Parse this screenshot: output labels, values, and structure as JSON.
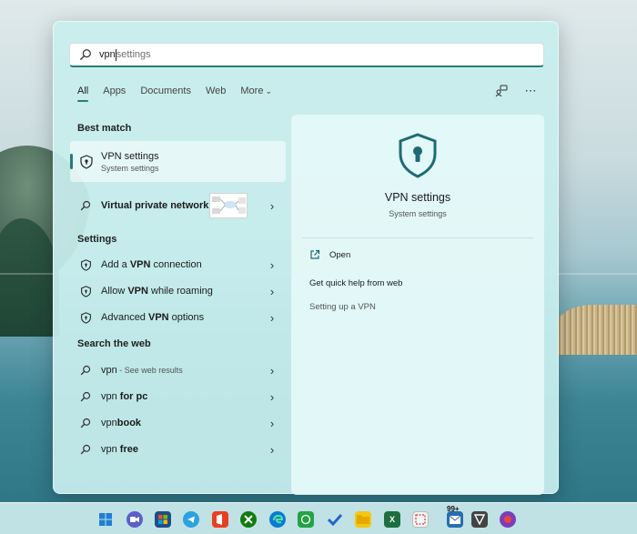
{
  "search": {
    "typed": "vpn",
    "ghost": "settings"
  },
  "tabs": [
    {
      "label": "All"
    },
    {
      "label": "Apps"
    },
    {
      "label": "Documents"
    },
    {
      "label": "Web"
    },
    {
      "label": "More"
    }
  ],
  "sections": {
    "best_match": "Best match",
    "settings": "Settings",
    "search_web": "Search the web"
  },
  "best_match": {
    "title": "VPN settings",
    "subtitle": "System settings"
  },
  "vpn_row": {
    "label": "Virtual private network"
  },
  "settings_items": [
    {
      "pre": "Add a ",
      "bold": "VPN",
      "post": " connection"
    },
    {
      "pre": "Allow ",
      "bold": "VPN",
      "post": " while roaming"
    },
    {
      "pre": "Advanced ",
      "bold": "VPN",
      "post": " options"
    }
  ],
  "web_items": [
    {
      "pre": "vpn",
      "bold": "",
      "sub": " - See web results"
    },
    {
      "pre": "vpn ",
      "bold": "for pc",
      "sub": ""
    },
    {
      "pre": "vpn",
      "bold": "book",
      "sub": ""
    },
    {
      "pre": "vpn ",
      "bold": "free",
      "sub": ""
    }
  ],
  "detail": {
    "title": "VPN settings",
    "subtitle": "System settings",
    "open": "Open",
    "quick_help": "Get quick help from web",
    "setup": "Setting up a VPN"
  },
  "taskbar": {
    "badge": "99+"
  },
  "colors": {
    "accent": "#2a7a7a",
    "panel": "#c8eeee"
  }
}
